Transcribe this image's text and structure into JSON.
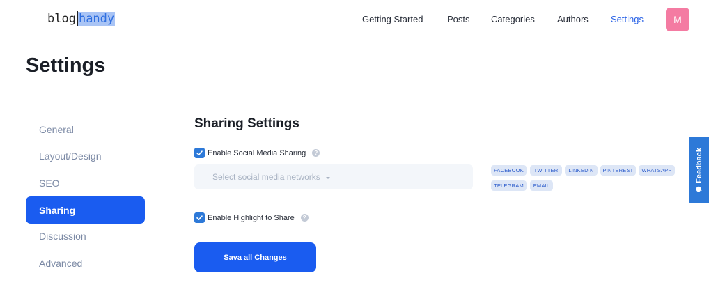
{
  "logo": {
    "part1": "blog",
    "part2": "handy"
  },
  "nav": {
    "items": [
      {
        "label": "Getting Started"
      },
      {
        "label": "Posts"
      },
      {
        "label": "Categories"
      },
      {
        "label": "Authors"
      },
      {
        "label": "Settings",
        "active": true
      }
    ],
    "avatar_initial": "M"
  },
  "page": {
    "title": "Settings"
  },
  "sidebar": {
    "items": [
      {
        "label": "General"
      },
      {
        "label": "Layout/Design"
      },
      {
        "label": "SEO"
      },
      {
        "label": "Sharing",
        "active": true
      },
      {
        "label": "Discussion"
      },
      {
        "label": "Advanced"
      }
    ]
  },
  "sharing": {
    "title": "Sharing Settings",
    "enable_social": {
      "label": "Enable Social Media Sharing",
      "checked": true
    },
    "select": {
      "placeholder": "Select social media networks"
    },
    "networks": [
      "FACEBOOK",
      "TWITTER",
      "LINKEDIN",
      "PINTEREST",
      "WHATSAPP",
      "TELEGRAM",
      "EMAIL"
    ],
    "enable_highlight": {
      "label": "Enable Highlight to Share",
      "checked": true
    },
    "save_label": "Sava all Changes"
  },
  "feedback": {
    "label": "Feedback"
  },
  "colors": {
    "accent": "#1a5cf0",
    "avatar": "#f47ba2",
    "tag_bg": "#dde6f6",
    "checkbox": "#2d79d8"
  },
  "icons": {
    "help": "help-circle-icon",
    "check": "check-icon",
    "caret": "caret-down-icon",
    "feedback": "chat-bubble-icon"
  }
}
